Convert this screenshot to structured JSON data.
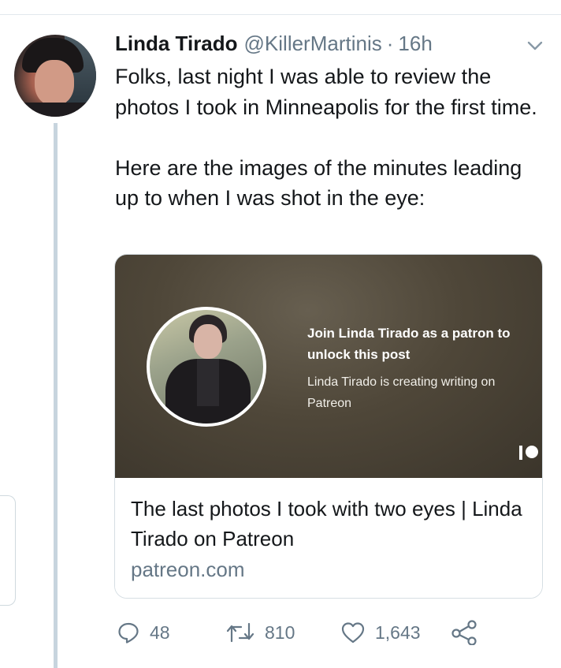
{
  "tweet": {
    "author_name": "Linda Tirado",
    "handle": "@KillerMartinis",
    "separator": "·",
    "time": "16h",
    "text": "Folks, last night I was able to review the photos I took in Minneapolis for the first time.\n\nHere are the images of the minutes leading up to when I was shot in the eye:"
  },
  "card": {
    "patron_title": "Join Linda Tirado as a patron to unlock this post",
    "patron_subtitle": "Linda Tirado is creating writing on Patreon",
    "title": "The last photos I took with two eyes | Linda Tirado on Patreon",
    "domain": "patreon.com"
  },
  "actions": {
    "replies": "48",
    "retweets": "810",
    "likes": "1,643"
  },
  "icons": {
    "menu": "chevron-down-icon",
    "reply": "reply-icon",
    "retweet": "retweet-icon",
    "like": "heart-icon",
    "share": "share-icon",
    "brand": "patreon-logo-icon"
  },
  "colors": {
    "text": "#14171a",
    "secondary": "#657786",
    "thread_line": "#c7d4de",
    "card_image_bg": "#4f4739"
  }
}
